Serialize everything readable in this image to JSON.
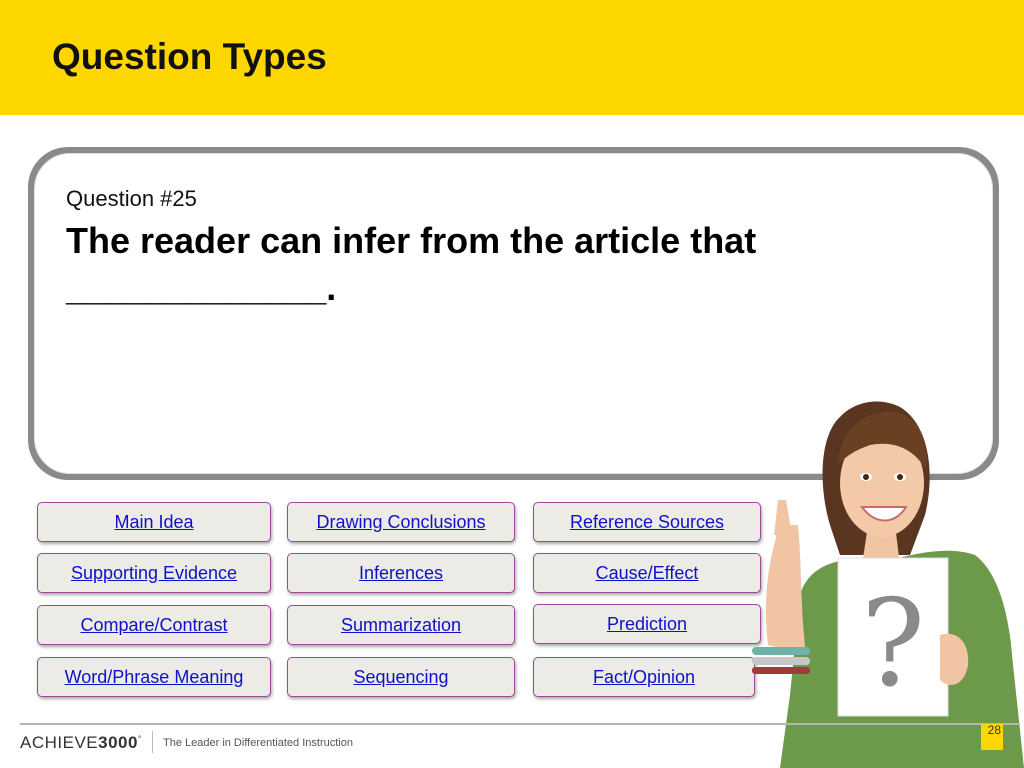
{
  "slide": {
    "title": "Question Types",
    "question_number": "Question #25",
    "question_text": "The reader can infer from the article that",
    "question_blank": "_____________."
  },
  "buttons": [
    {
      "label": "Main Idea"
    },
    {
      "label": "Drawing Conclusions"
    },
    {
      "label": "Reference Sources"
    },
    {
      "label": "Supporting Evidence"
    },
    {
      "label": "Inferences"
    },
    {
      "label": "Cause/Effect"
    },
    {
      "label": "Compare/Contrast"
    },
    {
      "label": "Summarization"
    },
    {
      "label": "Prediction"
    },
    {
      "label": "Word/Phrase Meaning"
    },
    {
      "label": "Sequencing"
    },
    {
      "label": "Fact/Opinion"
    }
  ],
  "footer": {
    "logo_prefix": "ACHIEVE",
    "logo_number": "3000",
    "logo_mark": "°",
    "tagline": "The Leader in Differentiated Instruction",
    "page_number": "28"
  },
  "illustration": {
    "sign_symbol": "?"
  },
  "colors": {
    "header": "#FFD700",
    "button_border": "#A0489C",
    "button_bg": "#ECEBE5",
    "link": "#1010CC"
  }
}
